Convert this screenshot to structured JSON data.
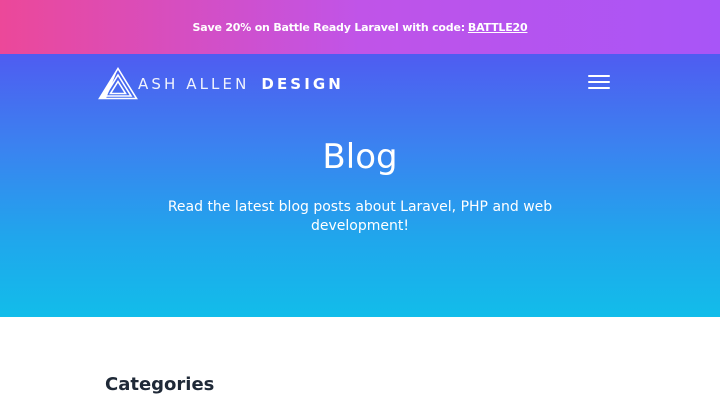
{
  "promo": {
    "text": "Save 20% on Battle Ready Laravel with code:",
    "code": "BATTLE20"
  },
  "header": {
    "logo_light": "ASH ALLEN",
    "logo_bold": "DESIGN",
    "menu_icon": "hamburger-menu-icon"
  },
  "hero": {
    "title": "Blog",
    "subtitle": "Read the latest blog posts about Laravel, PHP and web development!"
  },
  "main": {
    "categories_heading": "Categories"
  },
  "colors": {
    "banner_start": "#ec4899",
    "banner_end": "#a855f7",
    "hero_top": "#4f5cf1",
    "hero_bottom": "#12bdea",
    "heading_text": "#1f2937"
  }
}
